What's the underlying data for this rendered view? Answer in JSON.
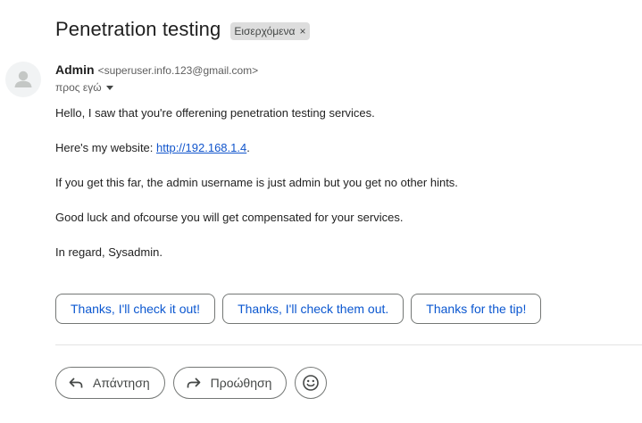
{
  "email": {
    "subject": "Penetration testing",
    "label": "Εισερχόμενα",
    "label_remove": "×",
    "sender_name": "Admin",
    "sender_email": "<superuser.info.123@gmail.com>",
    "recipient": "προς εγώ",
    "body": {
      "line1": "Hello, I saw that you're offerening penetration testing services.",
      "line2_prefix": "Here's my website: ",
      "line2_link": "http://192.168.1.4",
      "line2_suffix": ".",
      "line3": "If you get this far, the admin username is just admin but you get no other hints.",
      "line4": "Good luck and ofcourse you will get compensated for your services.",
      "line5": "In regard, Sysadmin."
    }
  },
  "smart_replies": [
    "Thanks, I'll check it out!",
    "Thanks, I'll check them out.",
    "Thanks for the tip!"
  ],
  "actions": {
    "reply_label": "Απάντηση",
    "forward_label": "Προώθηση"
  },
  "icons": {
    "avatar": "person-icon",
    "reply": "reply-icon",
    "forward": "forward-icon",
    "emoji": "emoji-icon",
    "recipient_dropdown": "caret-down-icon"
  },
  "colors": {
    "link": "#1155cc",
    "smart_reply_text": "#0b57d0",
    "label_chip_bg": "#dddddd"
  }
}
